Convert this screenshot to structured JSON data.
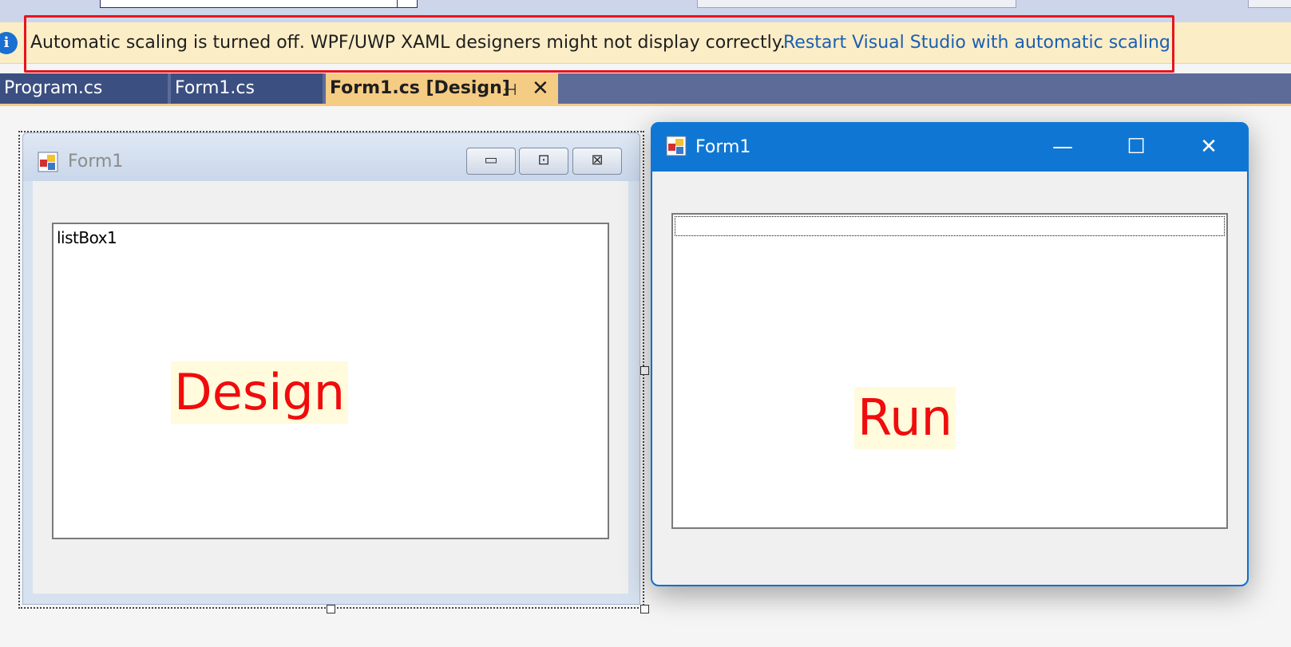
{
  "infobar": {
    "message": "Automatic scaling is turned off. WPF/UWP XAML designers might not display correctly.",
    "link": "Restart Visual Studio with automatic scaling",
    "icon": "info-icon"
  },
  "tabs": [
    {
      "label": "Program.cs",
      "active": false
    },
    {
      "label": "Form1.cs",
      "active": false
    },
    {
      "label": "Form1.cs [Design]",
      "active": true
    }
  ],
  "tab_pin_glyph": "⊣",
  "tab_close_glyph": "✕",
  "design_form": {
    "title": "Form1",
    "listbox_label": "listBox1",
    "caption_minimize": "▭",
    "caption_maximize": "⊡",
    "caption_close": "⊠"
  },
  "run_form": {
    "title": "Form1",
    "caption_minimize": "—",
    "caption_maximize": "☐",
    "caption_close": "✕"
  },
  "annotations": {
    "design": "Design",
    "run": "Run",
    "color": "#f00c0c",
    "highlight_color": "#e8141c"
  },
  "colors": {
    "infobar_bg": "#fbedc6",
    "tab_active_bg": "#f5cc84",
    "tab_inactive_bg": "#3b4f81",
    "run_titlebar": "#0f77d3",
    "link": "#1a5fb4"
  }
}
